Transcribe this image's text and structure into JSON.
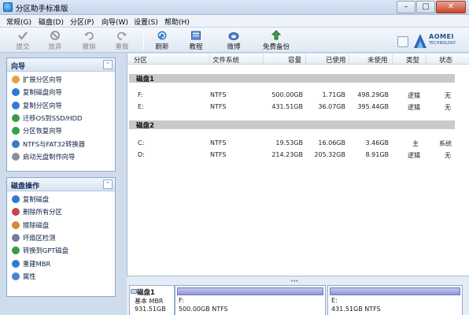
{
  "window": {
    "title": "分区助手标准版",
    "min": "–",
    "max": "□",
    "close": "✕"
  },
  "menu": [
    "常规(G)",
    "磁盘(D)",
    "分区(P)",
    "向导(W)",
    "设置(S)",
    "帮助(H)"
  ],
  "toolbar": {
    "items": [
      {
        "label": "提交",
        "icon": "check-icon",
        "enabled": false
      },
      {
        "label": "放弃",
        "icon": "discard-icon",
        "enabled": false
      },
      {
        "label": "撤销",
        "icon": "undo-icon",
        "enabled": false
      },
      {
        "label": "重做",
        "icon": "redo-icon",
        "enabled": false
      },
      {
        "label": "刷新",
        "icon": "refresh-icon",
        "enabled": true
      },
      {
        "label": "教程",
        "icon": "book-icon",
        "enabled": true
      },
      {
        "label": "微博",
        "icon": "weibo-icon",
        "enabled": true
      },
      {
        "label": "免费备份",
        "icon": "backup-icon",
        "enabled": true
      }
    ],
    "logo_name": "AOMEI",
    "logo_sub": "TECHNOLOGY"
  },
  "wizard_panel": {
    "title": "向导",
    "toggle": "⌃",
    "items": [
      {
        "label": "扩展分区向导",
        "icon": "extend-icon",
        "color": "#e7a03b"
      },
      {
        "label": "复制磁盘向导",
        "icon": "copy-disk-icon",
        "color": "#2f7bd1"
      },
      {
        "label": "复制分区向导",
        "icon": "copy-partition-icon",
        "color": "#2f7bd1"
      },
      {
        "label": "迁移OS到SSD/HDD",
        "icon": "migrate-icon",
        "color": "#3a9a4a"
      },
      {
        "label": "分区恢复向导",
        "icon": "recover-icon",
        "color": "#36a04d"
      },
      {
        "label": "NTFS与FAT32转换器",
        "icon": "convert-icon",
        "color": "#3b78c9"
      },
      {
        "label": "启动光盘制作向导",
        "icon": "boot-disc-icon",
        "color": "#8a8fa0"
      }
    ]
  },
  "disk_panel": {
    "title": "磁盘操作",
    "toggle": "⌃",
    "items": [
      {
        "label": "复制磁盘",
        "icon": "copy-disk-icon",
        "color": "#2f7bd1"
      },
      {
        "label": "删除所有分区",
        "icon": "delete-all-icon",
        "color": "#c74646"
      },
      {
        "label": "擦除磁盘",
        "icon": "wipe-icon",
        "color": "#d58a2e"
      },
      {
        "label": "坏扇区检测",
        "icon": "bad-sector-icon",
        "color": "#6b7fa0"
      },
      {
        "label": "转换到GPT磁盘",
        "icon": "gpt-icon",
        "color": "#3a9a4a"
      },
      {
        "label": "重建MBR",
        "icon": "mbr-icon",
        "color": "#2f7bd1"
      },
      {
        "label": "属性",
        "icon": "properties-icon",
        "color": "#4a86cf"
      }
    ]
  },
  "table": {
    "headers": [
      "分区",
      "文件系统",
      "容量",
      "已使用",
      "未使用",
      "类型",
      "状态"
    ],
    "disks": [
      {
        "name": "磁盘1",
        "rows": [
          [
            "F:",
            "NTFS",
            "500.00GB",
            "1.71GB",
            "498.29GB",
            "逻辑",
            "无"
          ],
          [
            "E:",
            "NTFS",
            "431.51GB",
            "36.07GB",
            "395.44GB",
            "逻辑",
            "无"
          ]
        ]
      },
      {
        "name": "磁盘2",
        "rows": [
          [
            "C:",
            "NTFS",
            "19.53GB",
            "16.06GB",
            "3.46GB",
            "主",
            "系统"
          ],
          [
            "D:",
            "NTFS",
            "214.23GB",
            "205.32GB",
            "8.91GB",
            "逻辑",
            "无"
          ]
        ]
      }
    ]
  },
  "disk_map": {
    "grip": "•••",
    "disk": {
      "title": "磁盘1",
      "type": "基本 MBR",
      "size": "931.51GB"
    },
    "partitions": [
      {
        "label": "F:",
        "size": "500.00GB NTFS"
      },
      {
        "label": "E:",
        "size": "431.51GB NTFS"
      }
    ]
  }
}
